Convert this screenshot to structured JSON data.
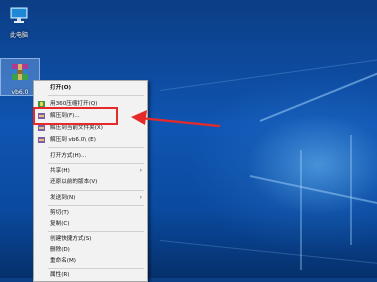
{
  "desktop": {
    "icons": [
      {
        "label": "此电脑",
        "icon": "computer-icon"
      },
      {
        "label": "vb6.0",
        "icon": "winrar-archive-icon"
      }
    ]
  },
  "context_menu": {
    "items": [
      {
        "label": "打开(O)",
        "bold": true
      },
      {
        "label": "用360压缩打开(Q)",
        "icon": "360zip-icon"
      },
      {
        "label": "解压到(F)...",
        "icon": "extract-icon"
      },
      {
        "label": "解压到当前文件夹(X)",
        "icon": "extract-icon"
      },
      {
        "label": "解压到 vb6.0\\ (E)",
        "icon": "extract-icon"
      },
      {
        "label": "打开方式(H)..."
      },
      {
        "label": "共享(H)",
        "submenu": true
      },
      {
        "label": "还原以前的版本(V)"
      },
      {
        "label": "发送到(N)",
        "submenu": true
      },
      {
        "label": "剪切(T)"
      },
      {
        "label": "复制(C)"
      },
      {
        "label": "创建快捷方式(S)"
      },
      {
        "label": "删除(D)"
      },
      {
        "label": "重命名(M)"
      },
      {
        "label": "属性(R)"
      }
    ]
  },
  "colors": {
    "annotation": "#e52a2a",
    "menu_background": "#f2f2f2"
  }
}
